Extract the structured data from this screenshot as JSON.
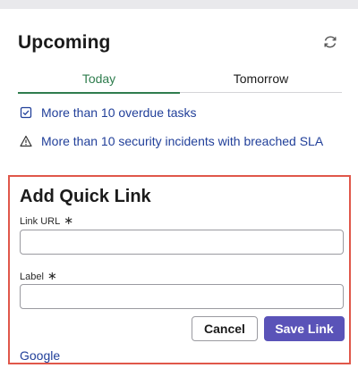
{
  "widget": {
    "title": "Upcoming",
    "refresh_icon": "refresh-icon",
    "tabs": [
      {
        "label": "Today",
        "active": true
      },
      {
        "label": "Tomorrow",
        "active": false
      }
    ],
    "alerts": [
      {
        "icon": "checkbox-icon",
        "text": "More than 10 overdue tasks"
      },
      {
        "icon": "warning-icon",
        "text": "More than 10 security incidents with breached SLA"
      }
    ]
  },
  "quick_link": {
    "title": "Add Quick Link",
    "url_label": "Link URL",
    "url_value": "",
    "label_label": "Label",
    "label_value": "",
    "required_mark": "∗",
    "cancel_label": "Cancel",
    "save_label": "Save Link",
    "links": [
      "Google"
    ]
  },
  "colors": {
    "accent_green": "#2f7d4e",
    "link_blue": "#22409a",
    "primary_button": "#5a53b8",
    "highlight_border": "#e0574a"
  }
}
